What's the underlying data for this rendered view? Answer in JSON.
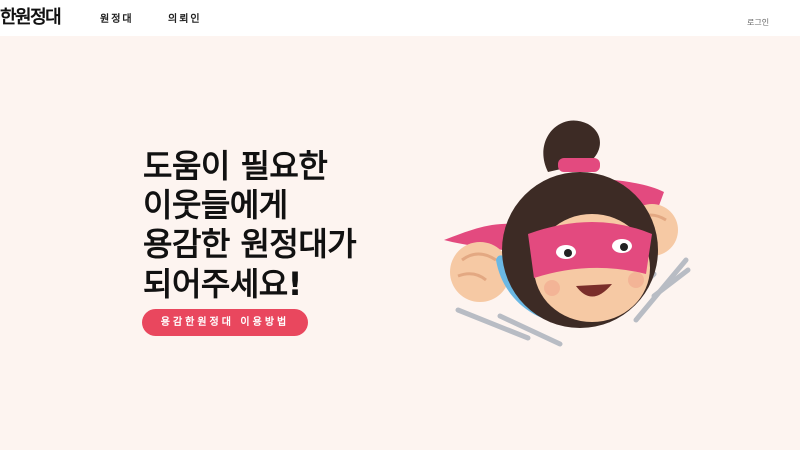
{
  "header": {
    "logo": "한원정대",
    "nav": [
      {
        "label": "원정대"
      },
      {
        "label": "의뢰인"
      }
    ],
    "login_label": "로그인"
  },
  "hero": {
    "lines": [
      "도움이 필요한",
      "이웃들에게",
      "용감한 원정대가",
      "되어주세요!"
    ],
    "cta_label": "용감한원정대 이용방법"
  },
  "colors": {
    "page_background": "#fdf4f0",
    "header_background": "#ffffff",
    "cta_background": "#e9475e",
    "hero_text": "#111111"
  }
}
